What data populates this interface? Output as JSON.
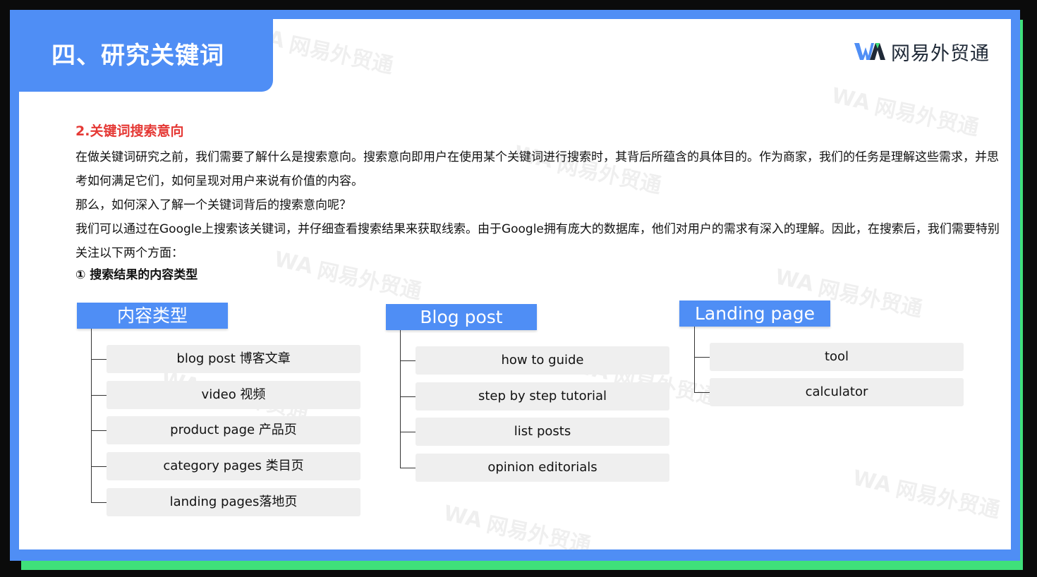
{
  "slide_title": "四、研究关键词",
  "logo_text": "网易外贸通",
  "watermark_text": "网易外贸通",
  "section_heading": "2.关键词搜索意向",
  "paragraphs": [
    "在做关键词研究之前，我们需要了解什么是搜索意向。搜索意向即用户在使用某个关键词进行搜索时，其背后所蕴含的具体目的。作为商家，我们的任务是理解这些需求，并思考如何满足它们，如何呈现对用户来说有价值的内容。",
    "那么，如何深入了解一个关键词背后的搜索意向呢？",
    "我们可以通过在Google上搜索该关键词，并仔细查看搜索结果来获取线索。由于Google拥有庞大的数据库，他们对用户的需求有深入的理解。因此，在搜索后，我们需要特别关注以下两个方面："
  ],
  "sub_heading": "① 搜索结果的内容类型",
  "columns": [
    {
      "title": "内容类型",
      "items": [
        "blog post 博客文章",
        "video 视频",
        "product page 产品页",
        "category pages 类目页",
        "landing pages落地页"
      ]
    },
    {
      "title": "Blog post",
      "items": [
        "how to guide",
        "step by step tutorial",
        "list posts",
        "opinion editorials"
      ]
    },
    {
      "title": "Landing page",
      "items": [
        "tool",
        "calculator"
      ]
    }
  ],
  "colors": {
    "brand_blue": "#4f8ef5",
    "accent_green": "#3fe07a",
    "heading_red": "#e53935"
  }
}
